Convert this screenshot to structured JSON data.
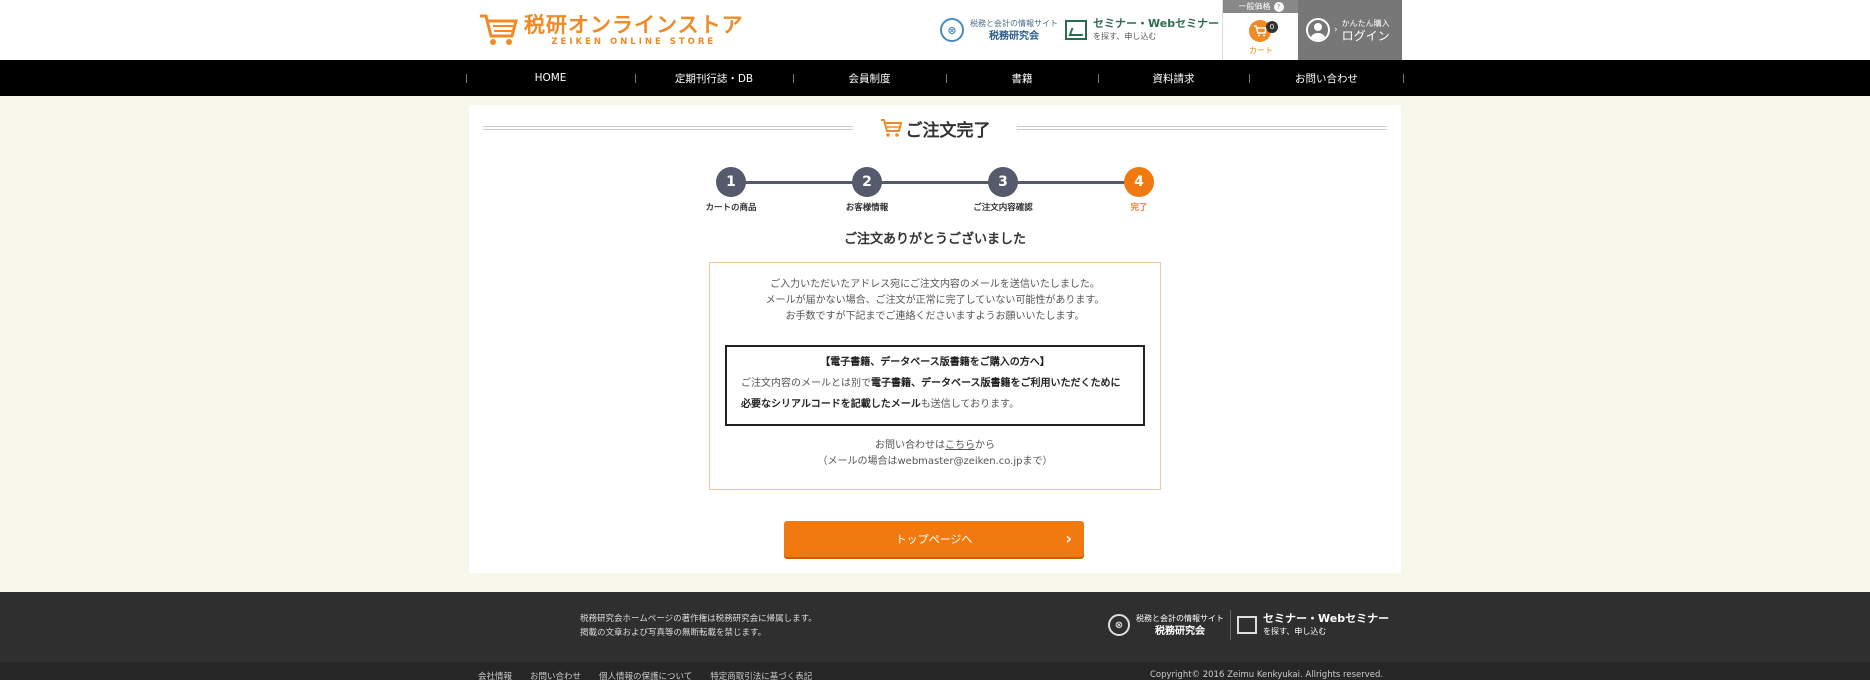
{
  "header": {
    "logo_main": "税研オンラインストア",
    "logo_sub": "ZEIKEN ONLINE STORE",
    "link1": {
      "small": "税務と会計の情報サイト",
      "big": "税務研究会"
    },
    "link2": {
      "big": "セミナー・Webセミナー",
      "small": "を探す、申し込む"
    },
    "price_tab": "一般価格",
    "cart_count": "0",
    "cart_label": "カート",
    "login_small": "かんたん購入",
    "login_big": "ログイン"
  },
  "nav": {
    "items": [
      {
        "label": "HOME"
      },
      {
        "label": "定期刊行誌・DB"
      },
      {
        "label": "会員制度"
      },
      {
        "label": "書籍"
      },
      {
        "label": "資料請求"
      },
      {
        "label": "お問い合わせ"
      }
    ]
  },
  "page": {
    "title": "ご注文完了",
    "steps": [
      {
        "num": "1",
        "label": "カートの商品"
      },
      {
        "num": "2",
        "label": "お客様情報"
      },
      {
        "num": "3",
        "label": "ご注文内容確認"
      },
      {
        "num": "4",
        "label": "完了"
      }
    ],
    "thanks": "ご注文ありがとうございました",
    "message": [
      "ご入力いただいたアドレス宛にご注文内容のメールを送信いたしました。",
      "メールが届かない場合、ご注文が正常に完了していない可能性があります。",
      "お手数ですが下記までご連絡くださいますようお願いいたします。"
    ],
    "notice_title": "【電子書籍、データベース版書籍をご購入の方へ】",
    "notice_body_1": "ご注文内容のメールとは別で",
    "notice_body_bold": "電子書籍、データベース版書籍をご利用いただくために必要なシリアルコードを記載したメール",
    "notice_body_2": "も送信しております。",
    "contact_pre": "お問い合わせは",
    "contact_link": "こちら",
    "contact_post": "から",
    "contact_mail": "（メールの場合はwebmaster@zeiken.co.jpまで）",
    "top_button": "トップページへ"
  },
  "footer": {
    "note_1": "税務研究会ホームページの著作権は税務研究会に帰属します。",
    "note_2": "掲載の文章および写真等の無断転載を禁じます。",
    "logo1": {
      "small": "税務と会計の情報サイト",
      "big": "税務研究会"
    },
    "logo2": {
      "big": "セミナー・Webセミナー",
      "small": "を探す、申し込む"
    },
    "links": [
      {
        "label": "会社情報"
      },
      {
        "label": "お問い合わせ"
      },
      {
        "label": "個人情報の保護について"
      },
      {
        "label": "特定商取引法に基づく表記"
      }
    ],
    "copyright": "Copyright© 2016 Zeimu Kenkyukai. Allrights reserved."
  },
  "colors": {
    "accent": "#f07a10",
    "nav_bg": "#000000",
    "step_dark": "#555a6c",
    "footer_bg": "#2f2f2f"
  },
  "icons": [
    "cart-icon",
    "zeiken-logo-icon",
    "seminar-board-icon",
    "user-icon",
    "chevron-right-icon",
    "question-icon"
  ]
}
